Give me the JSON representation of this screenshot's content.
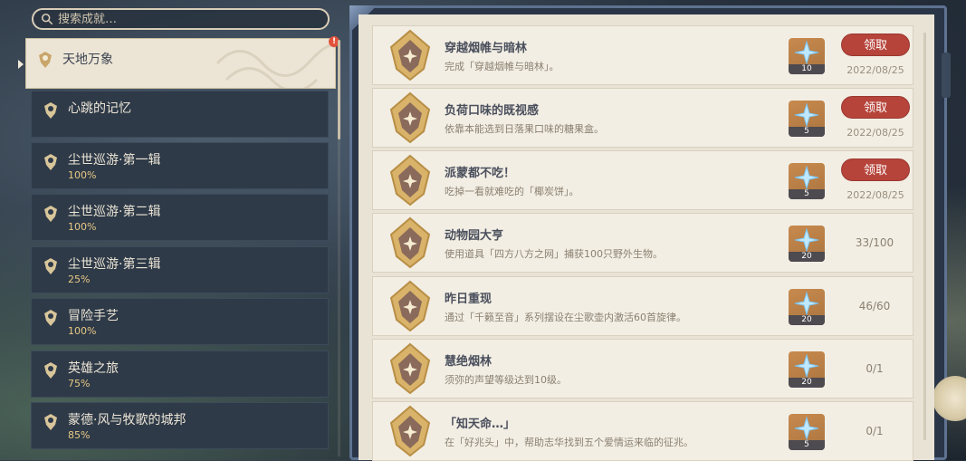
{
  "search": {
    "placeholder": "搜索成就…"
  },
  "categories": [
    {
      "title": "天地万象",
      "progress": "",
      "active": true
    },
    {
      "title": "心跳的记忆",
      "progress": ""
    },
    {
      "title": "尘世巡游·第一辑",
      "progress": "100%"
    },
    {
      "title": "尘世巡游·第二辑",
      "progress": "100%"
    },
    {
      "title": "尘世巡游·第三辑",
      "progress": "25%"
    },
    {
      "title": "冒险手艺",
      "progress": "100%"
    },
    {
      "title": "英雄之旅",
      "progress": "75%"
    },
    {
      "title": "蒙德·风与牧歌的城邦",
      "progress": "85%"
    }
  ],
  "alert_badge": "!",
  "achievements": [
    {
      "title": "穿越烟帷与暗林",
      "desc": "完成「穿越烟帷与暗林」。",
      "reward": "10",
      "claim": "领取",
      "date": "2022/08/25"
    },
    {
      "title": "负荷口味的既视感",
      "desc": "依靠本能选到日落果口味的糖果盒。",
      "reward": "5",
      "claim": "领取",
      "date": "2022/08/25"
    },
    {
      "title": "派蒙都不吃！",
      "desc": "吃掉一看就难吃的「椰炭饼」。",
      "reward": "5",
      "claim": "领取",
      "date": "2022/08/25"
    },
    {
      "title": "动物园大亨",
      "desc": "使用道具「四方八方之网」捕获100只野外生物。",
      "reward": "20",
      "progress": "33/100"
    },
    {
      "title": "昨日重现",
      "desc": "通过「千籁至音」系列摆设在尘歌壶内激活60首旋律。",
      "reward": "20",
      "progress": "46/60"
    },
    {
      "title": "慧绝烟林",
      "desc": "须弥的声望等级达到10级。",
      "reward": "20",
      "progress": "0/1"
    },
    {
      "title": "「知天命…」",
      "desc": "在「好兆头」中，帮助志华找到五个爱情运来临的征兆。",
      "reward": "5",
      "progress": "0/1"
    }
  ],
  "colors": {
    "claim_button": "#b6443a",
    "progress_text": "#e8c985",
    "panel_bg": "#e9e3d6"
  }
}
